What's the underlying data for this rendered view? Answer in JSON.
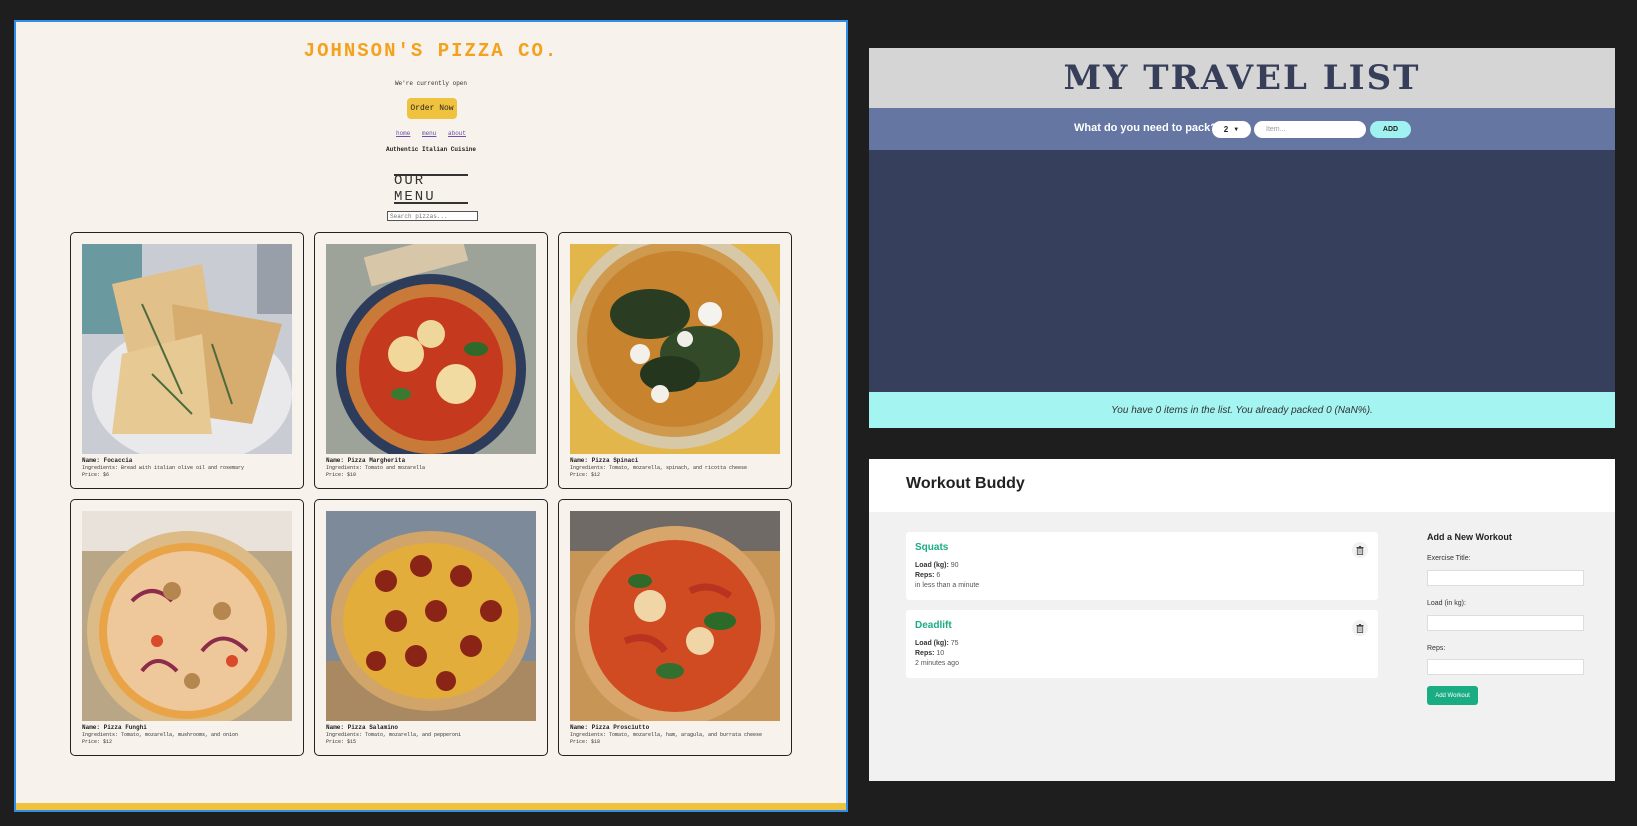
{
  "pizza": {
    "title": "JOHNSON'S PIZZA CO.",
    "status": "We're currently open",
    "order_button": "Order Now",
    "nav": [
      "home",
      "menu",
      "about"
    ],
    "tagline": "Authentic Italian Cuisine",
    "menu_heading": "OUR MENU",
    "search_placeholder": "Search pizzas...",
    "accent_color": "#f4a21d",
    "items": [
      {
        "name": "Name: Focaccia",
        "ingredients": "Ingredients: Bread with italian olive oil and rosemary",
        "price": "Price: $6",
        "image": "focaccia-photo"
      },
      {
        "name": "Name: Pizza Margherita",
        "ingredients": "Ingredients: Tomato and mozarella",
        "price": "Price: $10",
        "image": "margherita-photo"
      },
      {
        "name": "Name: Pizza Spinaci",
        "ingredients": "Ingredients: Tomato, mozarella, spinach, and ricotta cheese",
        "price": "Price: $12",
        "image": "spinaci-photo"
      },
      {
        "name": "Name: Pizza Funghi",
        "ingredients": "Ingredients: Tomato, mozarella, mushrooms, and onion",
        "price": "Price: $12",
        "image": "funghi-photo"
      },
      {
        "name": "Name: Pizza Salamino",
        "ingredients": "Ingredients: Tomato, mozarella, and pepperoni",
        "price": "Price: $15",
        "image": "salamino-photo"
      },
      {
        "name": "Name: Pizza Prosciutto",
        "ingredients": "Ingredients: Tomato, mozarella, ham, aragula, and burrata cheese",
        "price": "Price: $18",
        "image": "prosciutto-photo"
      }
    ]
  },
  "travel": {
    "title": "MY TRAVEL LIST",
    "question": "What do you need to pack?",
    "quantity": "2",
    "item_placeholder": "Item...",
    "add_label": "ADD",
    "stats": "You have 0 items in the list. You already packed 0 (NaN%)."
  },
  "workout": {
    "title": "Workout Buddy",
    "workouts": [
      {
        "title": "Squats",
        "load_label": "Load (kg):",
        "load": "90",
        "reps_label": "Reps:",
        "reps": "6",
        "ago": "in less than a minute"
      },
      {
        "title": "Deadlift",
        "load_label": "Load (kg):",
        "load": "75",
        "reps_label": "Reps:",
        "reps": "10",
        "ago": "2 minutes ago"
      }
    ],
    "form": {
      "title": "Add a New Workout",
      "exercise_label": "Exercise Title:",
      "load_label": "Load (in kg):",
      "reps_label": "Reps:",
      "submit": "Add Workout"
    },
    "accent_color": "#1aac83"
  }
}
